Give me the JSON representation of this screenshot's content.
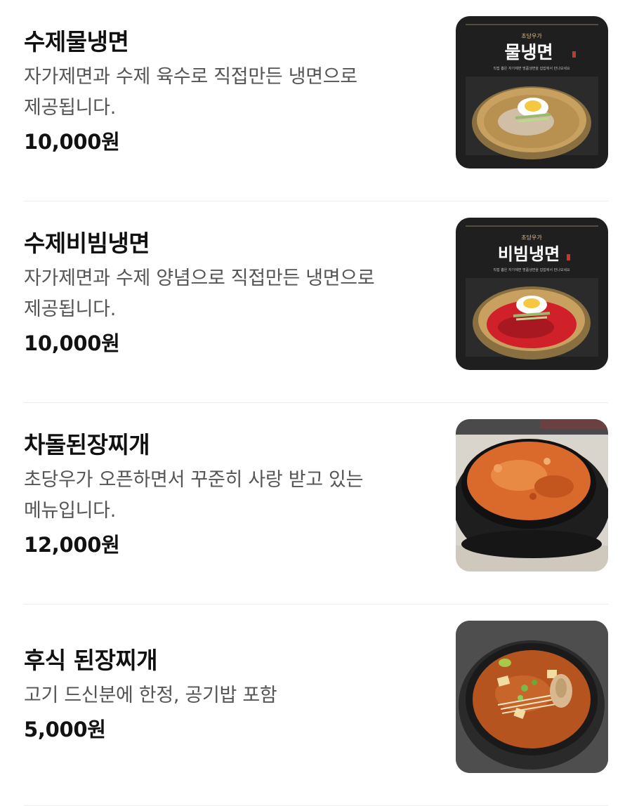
{
  "menu": {
    "items": [
      {
        "name": "수제물냉면",
        "description": "자가제면과 수제 육수로 직접만든 냉면으로 제공됩니다.",
        "price": "10,000원",
        "image": {
          "brand": "초당우가",
          "title": "물냉면",
          "caption": "직접 뽑은 자가제면 명품냉면을 집밥에서 만나보세요"
        }
      },
      {
        "name": "수제비빔냉면",
        "description": "자가제면과 수제 양념으로 직접만든 냉면으로 제공됩니다.",
        "price": "10,000원",
        "image": {
          "brand": "초당우가",
          "title": "비빔냉면",
          "caption": "직접 뽑은 자가제면 명품냉면을 집밥에서 만나보세요"
        }
      },
      {
        "name": "차돌된장찌개",
        "description": "초당우가 오픈하면서 꾸준히 사랑 받고 있는 메뉴입니다.",
        "price": "12,000원"
      },
      {
        "name": "후식 된장찌개",
        "description": "고기 드신분에 한정, 공기밥 포함",
        "price": "5,000원"
      }
    ]
  }
}
